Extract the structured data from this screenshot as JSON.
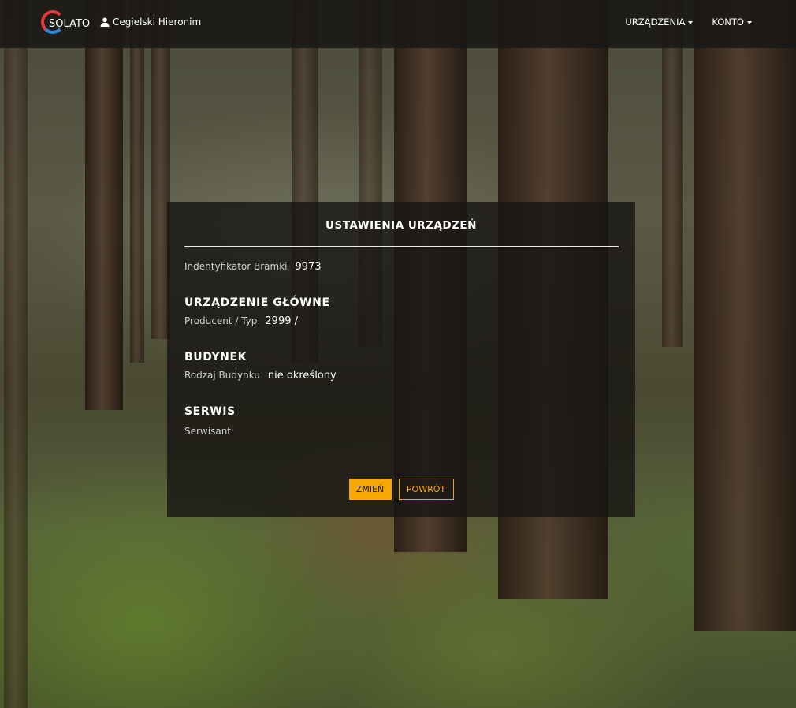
{
  "navbar": {
    "logo_text": "SOLATO",
    "user_name": "Cegielski Hieronim",
    "menu": [
      {
        "label": "URZĄDZENIA"
      },
      {
        "label": "KONTO"
      }
    ]
  },
  "panel": {
    "title": "USTAWIENIA URZĄDZEŃ",
    "gateway": {
      "label": "Indentyfikator Bramki",
      "value": "9973"
    },
    "main_device": {
      "heading": "URZĄDZENIE GŁÓWNE",
      "label": "Producent / Typ",
      "value": "2999 /"
    },
    "building": {
      "heading": "BUDYNEK",
      "label": "Rodzaj Budynku",
      "value": "nie określony"
    },
    "service": {
      "heading": "SERWIS",
      "label": "Serwisant"
    },
    "buttons": {
      "change": "ZMIEŃ",
      "back": "POWRÓT"
    }
  },
  "colors": {
    "accent": "#f5a800",
    "logo_red": "#e23a3a",
    "logo_blue": "#2e86d6"
  }
}
